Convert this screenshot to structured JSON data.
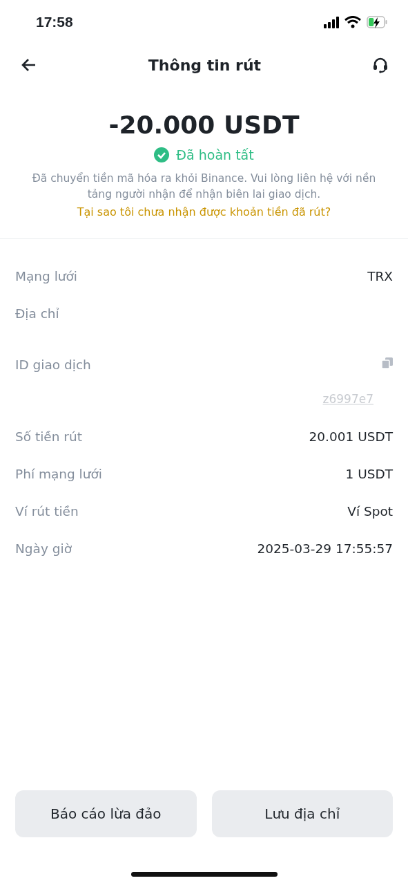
{
  "status_bar": {
    "time": "17:58",
    "battery_charging": true
  },
  "header": {
    "title": "Thông tin rút"
  },
  "summary": {
    "amount": "-20.000 USDT",
    "status": {
      "text": "Đã hoàn tất",
      "kind": "success"
    },
    "description": "Đã chuyển tiền mã hóa ra khỏi Binance. Vui lòng liên hệ với nền tảng người nhận để nhận biên lai giao dịch.",
    "help_link": "Tại sao tôi chưa nhận được khoản tiền đã rút?"
  },
  "details": [
    {
      "label": "Mạng lưới",
      "kind": "text",
      "value": "TRX"
    },
    {
      "label": "Địa chỉ",
      "kind": "hidden"
    },
    {
      "label": "ID giao dịch",
      "kind": "link",
      "value": "z6997e7"
    },
    {
      "label": "Số tiền rút",
      "kind": "text",
      "value": "20.001 USDT"
    },
    {
      "label": "Phí mạng lưới",
      "kind": "text",
      "value": "1 USDT"
    },
    {
      "label": "Ví rút tiền",
      "kind": "text",
      "value": "Ví Spot"
    },
    {
      "label": "Ngày giờ",
      "kind": "text",
      "value": "2025-03-29 17:55:57"
    }
  ],
  "buttons": [
    "Báo cáo lừa đảo",
    "Lưu địa chỉ"
  ]
}
